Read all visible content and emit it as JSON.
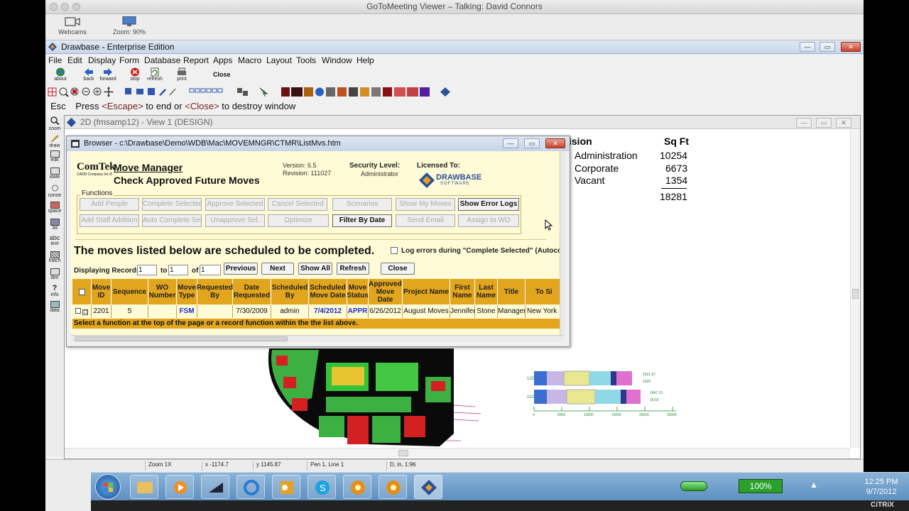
{
  "g2m": {
    "title": "GoToMeeting Viewer – Talking: David Connors",
    "webcams_label": "Webcams",
    "zoom_label": "Zoom: 90%"
  },
  "drawbase": {
    "title": "Drawbase - Enterprise Edition",
    "menu": [
      "File",
      "Edit",
      "Display",
      "Form",
      "Database",
      "Report",
      "Apps",
      "Macro",
      "Layout",
      "Tools",
      "Window",
      "Help"
    ],
    "toolbar": {
      "about": "about",
      "back": "back",
      "forward": "forward",
      "stop": "stop",
      "refresh": "refresh",
      "print": "print",
      "close": "Close"
    },
    "cmd": {
      "esc": "Esc",
      "pre": "Press ",
      "escape_kw": "<Escape>",
      "mid": " to end or ",
      "close_kw": "<Close>",
      "post": " to destroy window"
    },
    "side_labels": [
      "zoom",
      "draw",
      "edit",
      "xlate",
      "constr",
      "space",
      "3d",
      "text",
      "hatch",
      "dim",
      "info",
      "data"
    ],
    "side_glyphs": {
      "text": "abc",
      "info": "?"
    },
    "view_title": "2D (fmsamp12) - View 1 (DESIGN)",
    "status": {
      "zoom": "Zoom 1X",
      "x": "x -1174.7",
      "y": "y 1145.87",
      "pen": "Pen 1, Line 1",
      "dim": "D, in, 1:96"
    },
    "sqft": {
      "header_division": "ision",
      "header_sqft": "Sq Ft",
      "rows": [
        {
          "name": "Administration",
          "value": "10254"
        },
        {
          "name": "Corporate",
          "value": "6673"
        },
        {
          "name": "Vacant",
          "value": "1354"
        }
      ],
      "total": "18281"
    },
    "plan_labels": {
      "legend_ticks": [
        "0",
        "5000",
        "10000",
        "15000",
        "20000",
        "25000"
      ],
      "bar_labels": [
        "1621.97",
        "1020",
        "1847.13",
        "18.60"
      ],
      "row_labels": [
        "12G",
        "11G"
      ]
    }
  },
  "browser": {
    "title": "Browser - c:\\Drawbase\\Demo\\WDB\\Mac\\MOVEMNGR\\CTMR\\ListMvs.htm",
    "logo": "ComTek",
    "logo_sub": "CADD Company Inc.®",
    "app_name": "Move Manager",
    "page_title": "Check Approved Future Moves",
    "version": "Version: 6.5",
    "revision": "Revision: 111027",
    "security_label": "Security Level:",
    "security_value": "Administrator",
    "licensed_label": "Licensed To:",
    "licensed_logo": "DRAWBASE",
    "licensed_logo_sub": "SOFTWARE",
    "functions_label": "Functions",
    "functions_row1": [
      {
        "label": "Add People",
        "enabled": false
      },
      {
        "label": "Complete Selected",
        "enabled": false
      },
      {
        "label": "Approve Selected",
        "enabled": false
      },
      {
        "label": "Cancel Selected",
        "enabled": false
      },
      {
        "label": "Scenarios",
        "enabled": false
      },
      {
        "label": "Show My Moves",
        "enabled": false
      },
      {
        "label": "Show Error Logs",
        "enabled": true
      }
    ],
    "functions_row2": [
      {
        "label": "Add Staff Addition",
        "enabled": false
      },
      {
        "label": "Auto Complete Sel.",
        "enabled": false
      },
      {
        "label": "Unapprove Sel.",
        "enabled": false
      },
      {
        "label": "Optimize",
        "enabled": false
      },
      {
        "label": "Filter By Date",
        "enabled": true
      },
      {
        "label": "Send Email",
        "enabled": false
      },
      {
        "label": "Assign to WO",
        "enabled": false
      }
    ],
    "heading": "The moves listed below are scheduled to be completed.",
    "log_errors": "Log errors during \"Complete Selected\" (Autoco",
    "displaying": "Displaying Records",
    "from_val": "1",
    "to_label": "to",
    "to_val": "1",
    "of_label": "of",
    "of_val": "1",
    "nav": {
      "previous": "Previous",
      "next": "Next",
      "show_all": "Show All",
      "refresh": "Refresh",
      "close": "Close"
    },
    "columns": [
      "Move ID",
      "Sequence",
      "WO Number",
      "Move Type",
      "Requested By",
      "Date Requested",
      "Scheduled By",
      "Scheduled Move Date",
      "Move Status",
      "Approved Move Date",
      "Project Name",
      "First Name",
      "Last Name",
      "Title",
      "To Si"
    ],
    "row": {
      "move_id": "2201",
      "sequence": "5",
      "wo_number": "",
      "move_type": "FSM",
      "requested_by": "",
      "date_requested": "7/30/2009",
      "scheduled_by": "admin",
      "scheduled_move_date": "7/4/2012",
      "move_status": "APPR",
      "approved_move_date": "6/26/2012",
      "project_name": "August Moves",
      "first_name": "Jennifer",
      "last_name": "Stone",
      "title": "Manager",
      "to_site": "New York"
    },
    "footer": "Select a function at the top of the page or a record function within the the list above."
  },
  "taskbar": {
    "battery": "100%",
    "time": "12:25 PM",
    "date": "9/7/2012",
    "citrix": "CiTRiX"
  },
  "colors": {
    "header_gold": "#e2a51e",
    "body_yellow": "#fffbd6",
    "footer_gold": "#e2a51e",
    "blue_text": "#1b2cc9"
  }
}
